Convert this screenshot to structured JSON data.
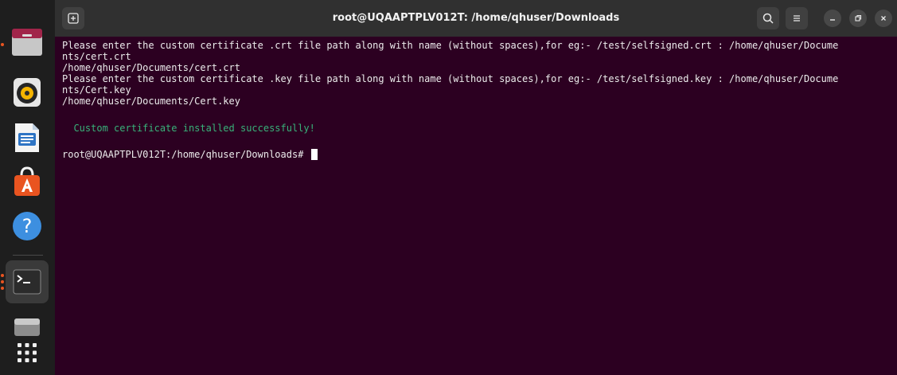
{
  "window": {
    "title": "root@UQAAPTPLV012T: /home/qhuser/Downloads"
  },
  "dock": {
    "items": [
      "files",
      "rhythmbox",
      "libreoffice-writer",
      "app-center",
      "help",
      "terminal",
      "drive",
      "show-apps"
    ]
  },
  "terminal": {
    "lines": [
      "Please enter the custom certificate .crt file path along with name (without spaces),for eg:- /test/selfsigned.crt : /home/qhuser/Docume",
      "nts/cert.crt",
      "/home/qhuser/Documents/cert.crt",
      "Please enter the custom certificate .key file path along with name (without spaces),for eg:- /test/selfsigned.key : /home/qhuser/Docume",
      "nts/Cert.key",
      "/home/qhuser/Documents/Cert.key"
    ],
    "success": "  Custom certificate installed successfully!",
    "prompt": "root@UQAAPTPLV012T:/home/qhuser/Downloads#"
  },
  "colors": {
    "terminal_bg": "#2c0021",
    "success_text": "#38b27a",
    "accent": "#e95420"
  }
}
